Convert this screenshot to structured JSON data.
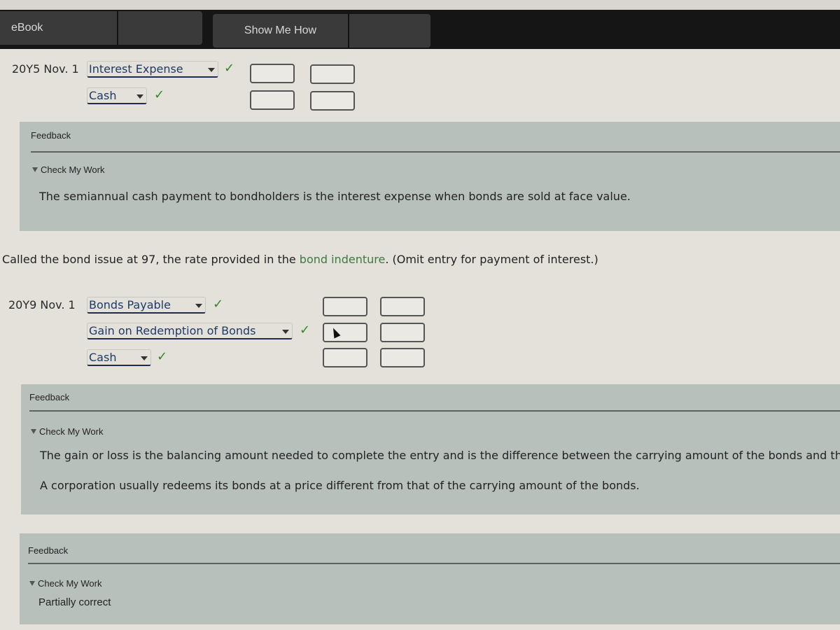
{
  "toolbar": {
    "ebook_label": "eBook",
    "show_me_how_label": "Show Me How"
  },
  "entry1": {
    "date": "20Y5 Nov. 1",
    "rows": [
      {
        "account": "Interest Expense",
        "status": "correct",
        "debit": "",
        "credit": ""
      },
      {
        "account": "Cash",
        "status": "correct",
        "debit": "",
        "credit": ""
      }
    ],
    "check_icon": "✓"
  },
  "feedback1": {
    "title": "Feedback",
    "check_my_work": "Check My Work",
    "message": "The semiannual cash payment to bondholders is the interest expense when bonds are sold at face value."
  },
  "instruction": {
    "text_before": "Called the bond issue at 97, the rate provided in the ",
    "link": "bond indenture",
    "text_after": ". (Omit entry for payment of interest.)"
  },
  "entry2": {
    "date": "20Y9 Nov. 1",
    "rows": [
      {
        "account": "Bonds Payable",
        "status": "correct",
        "debit": "",
        "credit": ""
      },
      {
        "account": "Gain on Redemption of Bonds",
        "status": "correct",
        "debit": "",
        "credit": ""
      },
      {
        "account": "Cash",
        "status": "correct",
        "debit": "",
        "credit": ""
      }
    ],
    "check_icon": "✓"
  },
  "feedback2": {
    "title": "Feedback",
    "check_my_work": "Check My Work",
    "message1": "The gain or loss is the balancing amount needed to complete the entry and is the difference between the carrying amount of the bonds and th",
    "message2": "A corporation usually redeems its bonds at a price different from that of the carrying amount of the bonds."
  },
  "feedback3": {
    "title": "Feedback",
    "check_my_work": "Check My Work",
    "result": "Partially correct"
  },
  "colors": {
    "correct": "#2f8a2a",
    "link": "#3d7a3d",
    "panel": "#b8c0bc"
  }
}
